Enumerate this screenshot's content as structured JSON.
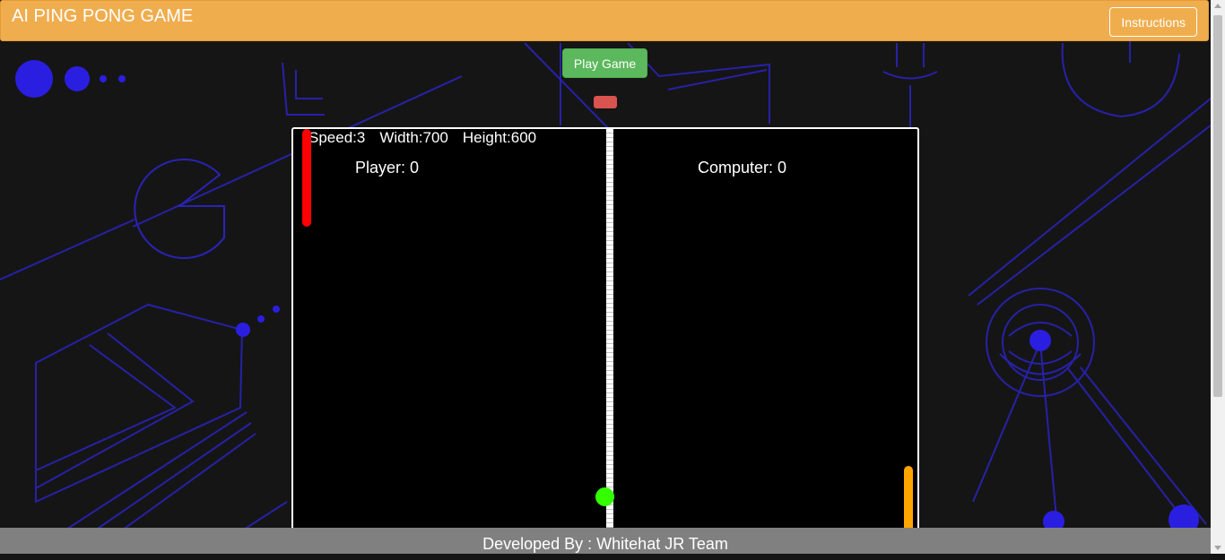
{
  "navbar": {
    "title": "AI PING PONG GAME",
    "instructions_label": "Instructions"
  },
  "controls": {
    "play_label": "Play Game"
  },
  "game": {
    "speed_text": "Speed:3",
    "width_text": "Width:700",
    "height_text": "Height:600",
    "player_score_text": "Player: 0",
    "computer_score_text": "Computer: 0",
    "colors": {
      "player_paddle": "#ff0000",
      "computer_paddle": "#ffa500",
      "ball": "#33ff00",
      "net": "#ffffff"
    }
  },
  "footer": {
    "text": "Developed By : Whitehat JR Team"
  },
  "theme": {
    "navbar": "#f0ad4e",
    "play_button": "#5cb85c",
    "status_indicator": "#d9534f",
    "background_lines": "#2a23b8"
  },
  "icons": [
    "pacman-outline-icon",
    "eye-target-icon",
    "dot-icon"
  ]
}
